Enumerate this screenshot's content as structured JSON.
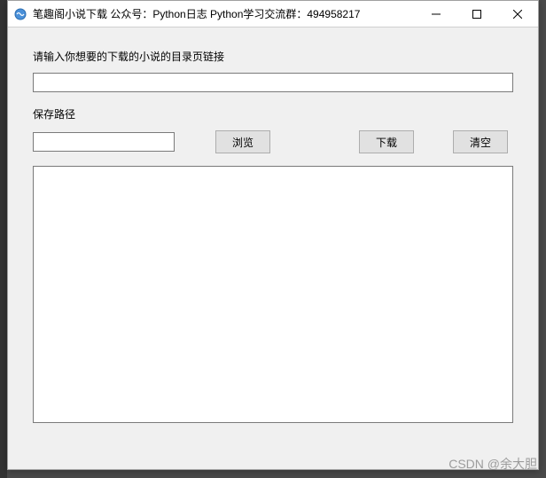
{
  "window": {
    "title": "笔趣阁小说下载  公众号：Python日志 Python学习交流群：494958217"
  },
  "labels": {
    "url_prompt": "请输入你想要的下载的小说的目录页链接",
    "save_path": "保存路径"
  },
  "inputs": {
    "url_value": "",
    "path_value": ""
  },
  "buttons": {
    "browse": "浏览",
    "download": "下载",
    "clear": "清空"
  },
  "output": {
    "content": ""
  },
  "watermark": "CSDN @余大胆"
}
